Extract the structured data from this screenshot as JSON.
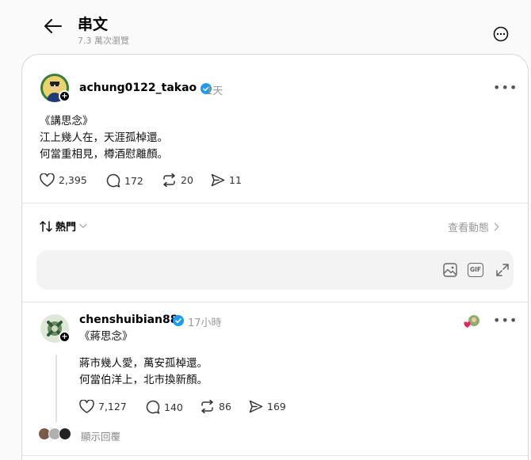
{
  "header": {
    "title": "串文",
    "subtitle": "7.3 萬次瀏覽"
  },
  "main_post": {
    "username": "achung0122_takao",
    "time": "1天",
    "lines": [
      "《講思念》",
      "江上幾人在，天涯孤棹還。",
      "何當重相見，樽酒慰離顏。"
    ],
    "likes": "2,395",
    "comments": "172",
    "reposts": "20",
    "shares": "11"
  },
  "sort": {
    "label": "熱門",
    "view_activity": "查看動態"
  },
  "reply_box": {
    "placeholder": "",
    "gif_label": "GIF"
  },
  "reply_post": {
    "username": "chenshuibian88",
    "time": "17小時",
    "lines": [
      "《蔣思念》",
      "蔣市幾人愛，萬安孤棹還。",
      "何當伯洋上，北市換新顏。"
    ],
    "likes": "7,127",
    "comments": "140",
    "reposts": "86",
    "shares": "169",
    "show_replies": "顯示回覆"
  },
  "colors": {
    "verified": "#1d9bf0",
    "like_heart": "#e0245e",
    "muted": "#999999"
  },
  "icons": {
    "back": "arrow-left-icon",
    "more": "more-circle-icon",
    "like": "heart-icon",
    "comment": "comment-icon",
    "repost": "repost-icon",
    "share": "share-icon",
    "sort": "sort-icon",
    "image": "image-icon",
    "expand": "expand-icon"
  }
}
